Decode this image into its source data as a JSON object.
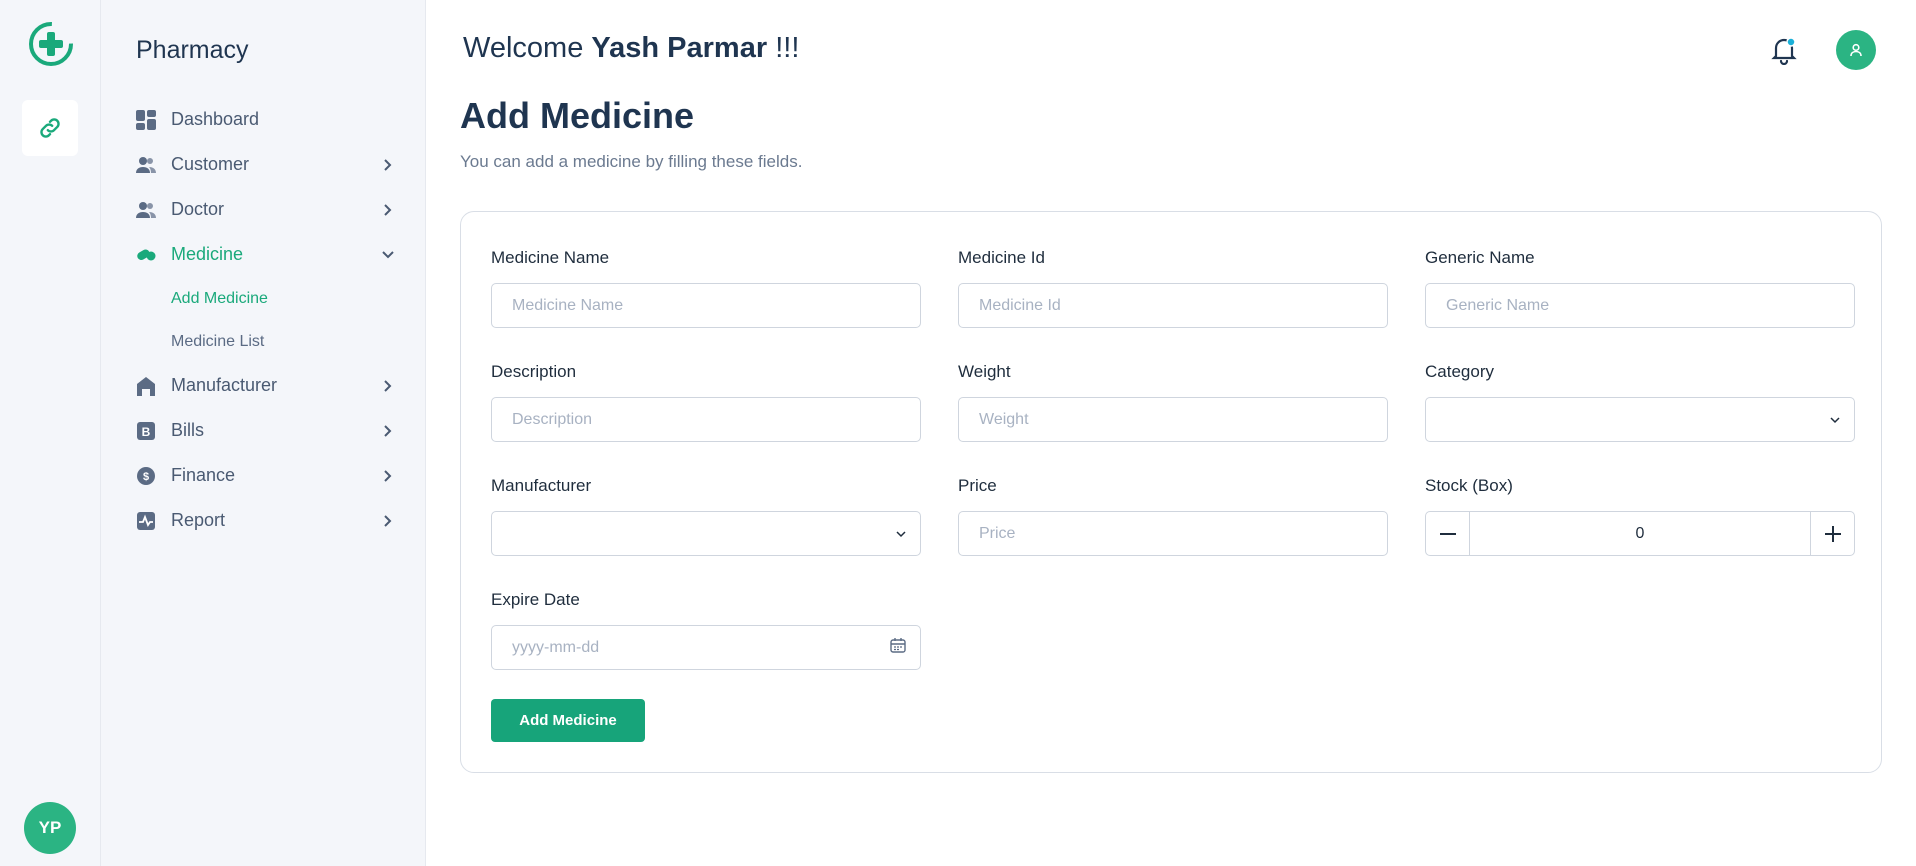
{
  "colors": {
    "accent": "#1aa97b",
    "avatar": "#2bb483",
    "text": "#1f3550",
    "muted": "#6b7a90"
  },
  "rail": {
    "avatar_initials": "YP"
  },
  "sidebar": {
    "brand": "Pharmacy",
    "items": [
      {
        "label": "Dashboard",
        "icon": "grid-icon"
      },
      {
        "label": "Customer",
        "icon": "users-icon"
      },
      {
        "label": "Doctor",
        "icon": "users-icon"
      },
      {
        "label": "Medicine",
        "icon": "pill-icon",
        "expanded": true
      },
      {
        "label": "Manufacturer",
        "icon": "factory-icon"
      },
      {
        "label": "Bills",
        "icon": "bill-icon"
      },
      {
        "label": "Finance",
        "icon": "dollar-icon"
      },
      {
        "label": "Report",
        "icon": "pulse-icon"
      }
    ],
    "medicine_sub": [
      "Add Medicine",
      "Medicine List"
    ]
  },
  "header": {
    "welcome_prefix": "Welcome",
    "user_name": "Yash Parmar",
    "welcome_suffix": "!!!"
  },
  "page": {
    "title": "Add Medicine",
    "subtitle": "You can add a medicine by filling these fields."
  },
  "form": {
    "medicine_name": {
      "label": "Medicine Name",
      "placeholder": "Medicine Name"
    },
    "medicine_id": {
      "label": "Medicine Id",
      "placeholder": "Medicine Id"
    },
    "generic_name": {
      "label": "Generic Name",
      "placeholder": "Generic Name"
    },
    "description": {
      "label": "Description",
      "placeholder": "Description"
    },
    "weight": {
      "label": "Weight",
      "placeholder": "Weight"
    },
    "category": {
      "label": "Category",
      "value": ""
    },
    "manufacturer": {
      "label": "Manufacturer",
      "value": ""
    },
    "price": {
      "label": "Price",
      "placeholder": "Price"
    },
    "stock": {
      "label": "Stock (Box)",
      "value": "0"
    },
    "expire_date": {
      "label": "Expire Date",
      "placeholder": "yyyy-mm-dd"
    },
    "submit_label": "Add Medicine"
  }
}
